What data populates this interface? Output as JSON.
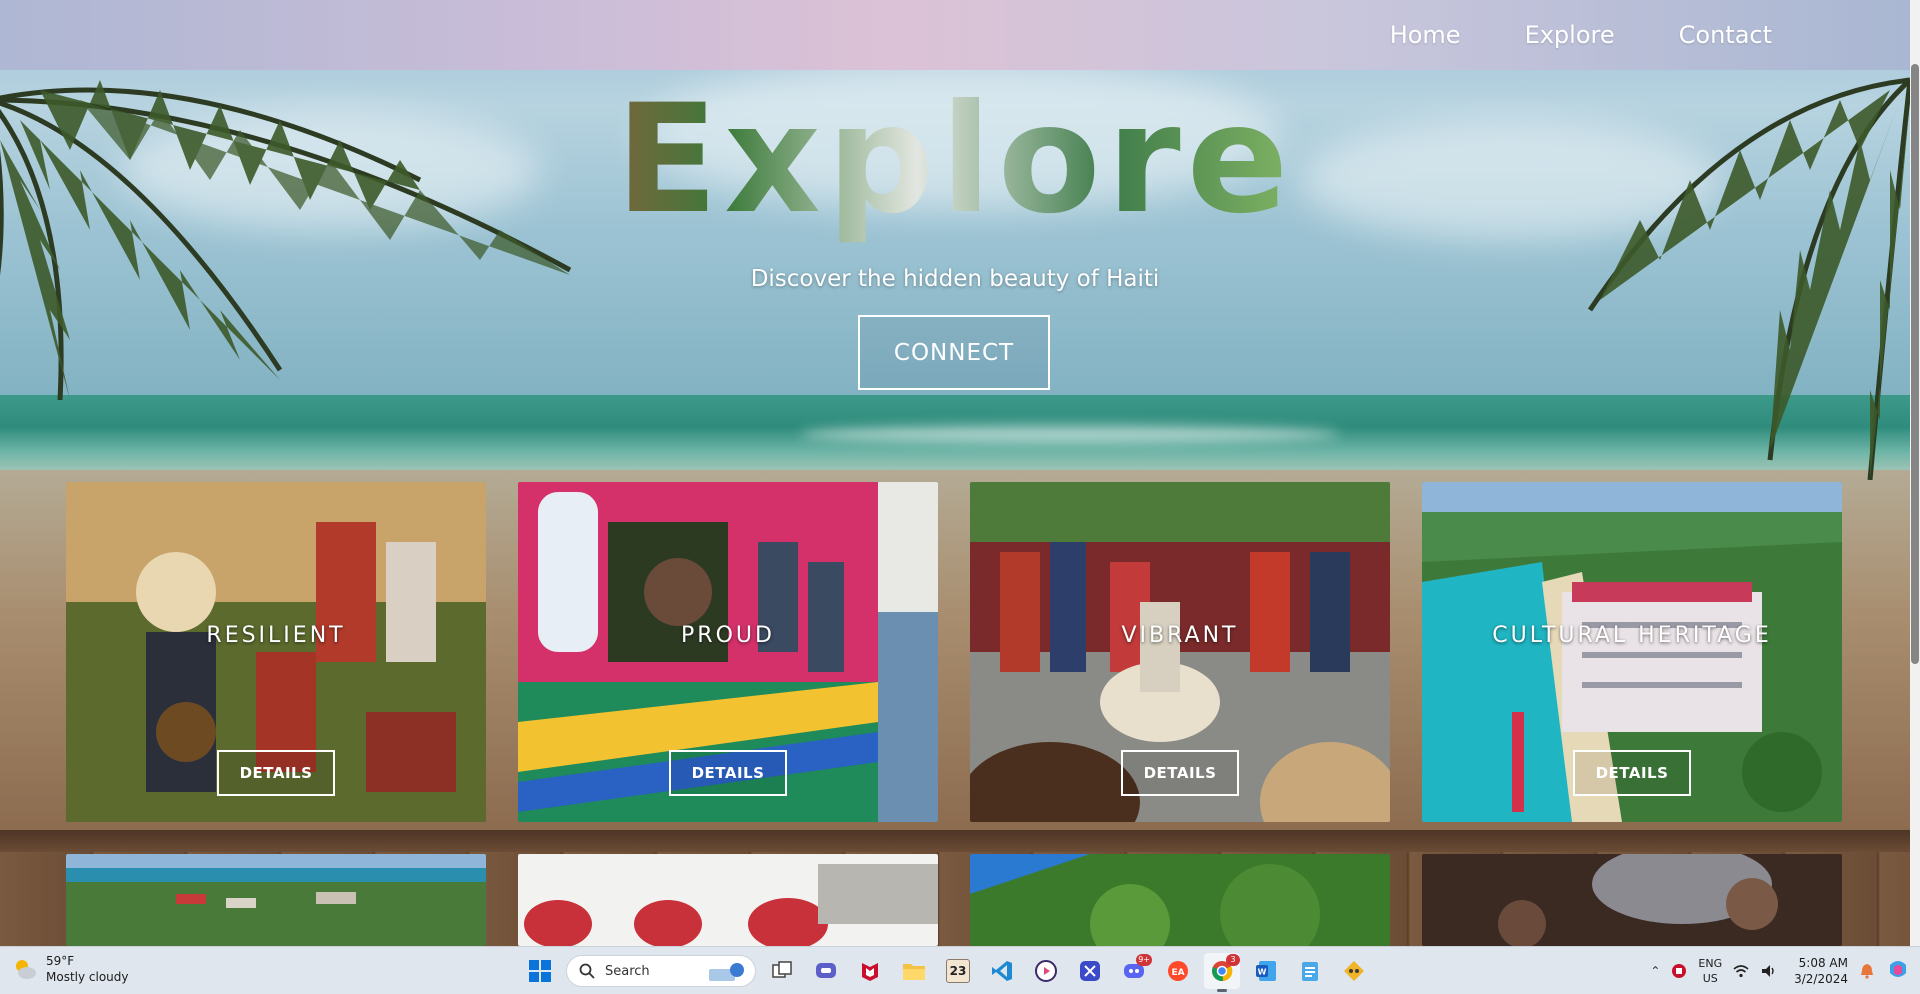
{
  "nav": {
    "links": [
      "Home",
      "Explore",
      "Contact"
    ]
  },
  "hero": {
    "title": "Explore",
    "subtitle": "Discover the hidden beauty of Haiti",
    "button": "CONNECT"
  },
  "cards_row1": [
    {
      "title": "RESILIENT",
      "button": "DETAILS"
    },
    {
      "title": "PROUD",
      "button": "DETAILS"
    },
    {
      "title": "VIBRANT",
      "button": "DETAILS"
    },
    {
      "title": "CULTURAL HERITAGE",
      "button": "DETAILS"
    }
  ],
  "taskbar": {
    "weather": {
      "temp": "59°F",
      "desc": "Mostly cloudy"
    },
    "search_label": "Search",
    "badges": {
      "discord": "9+",
      "chrome": "3"
    },
    "lang_top": "ENG",
    "lang_bottom": "US",
    "time": "5:08 AM",
    "date": "3/2/2024",
    "calendar_day": "23"
  },
  "colors": {
    "nav_gradient": [
      "#aeb7d3",
      "#dcc2d6",
      "#a9b7d2"
    ],
    "taskbar_bg": "#dfe6ee",
    "text_on_hero": "#ffffff"
  }
}
